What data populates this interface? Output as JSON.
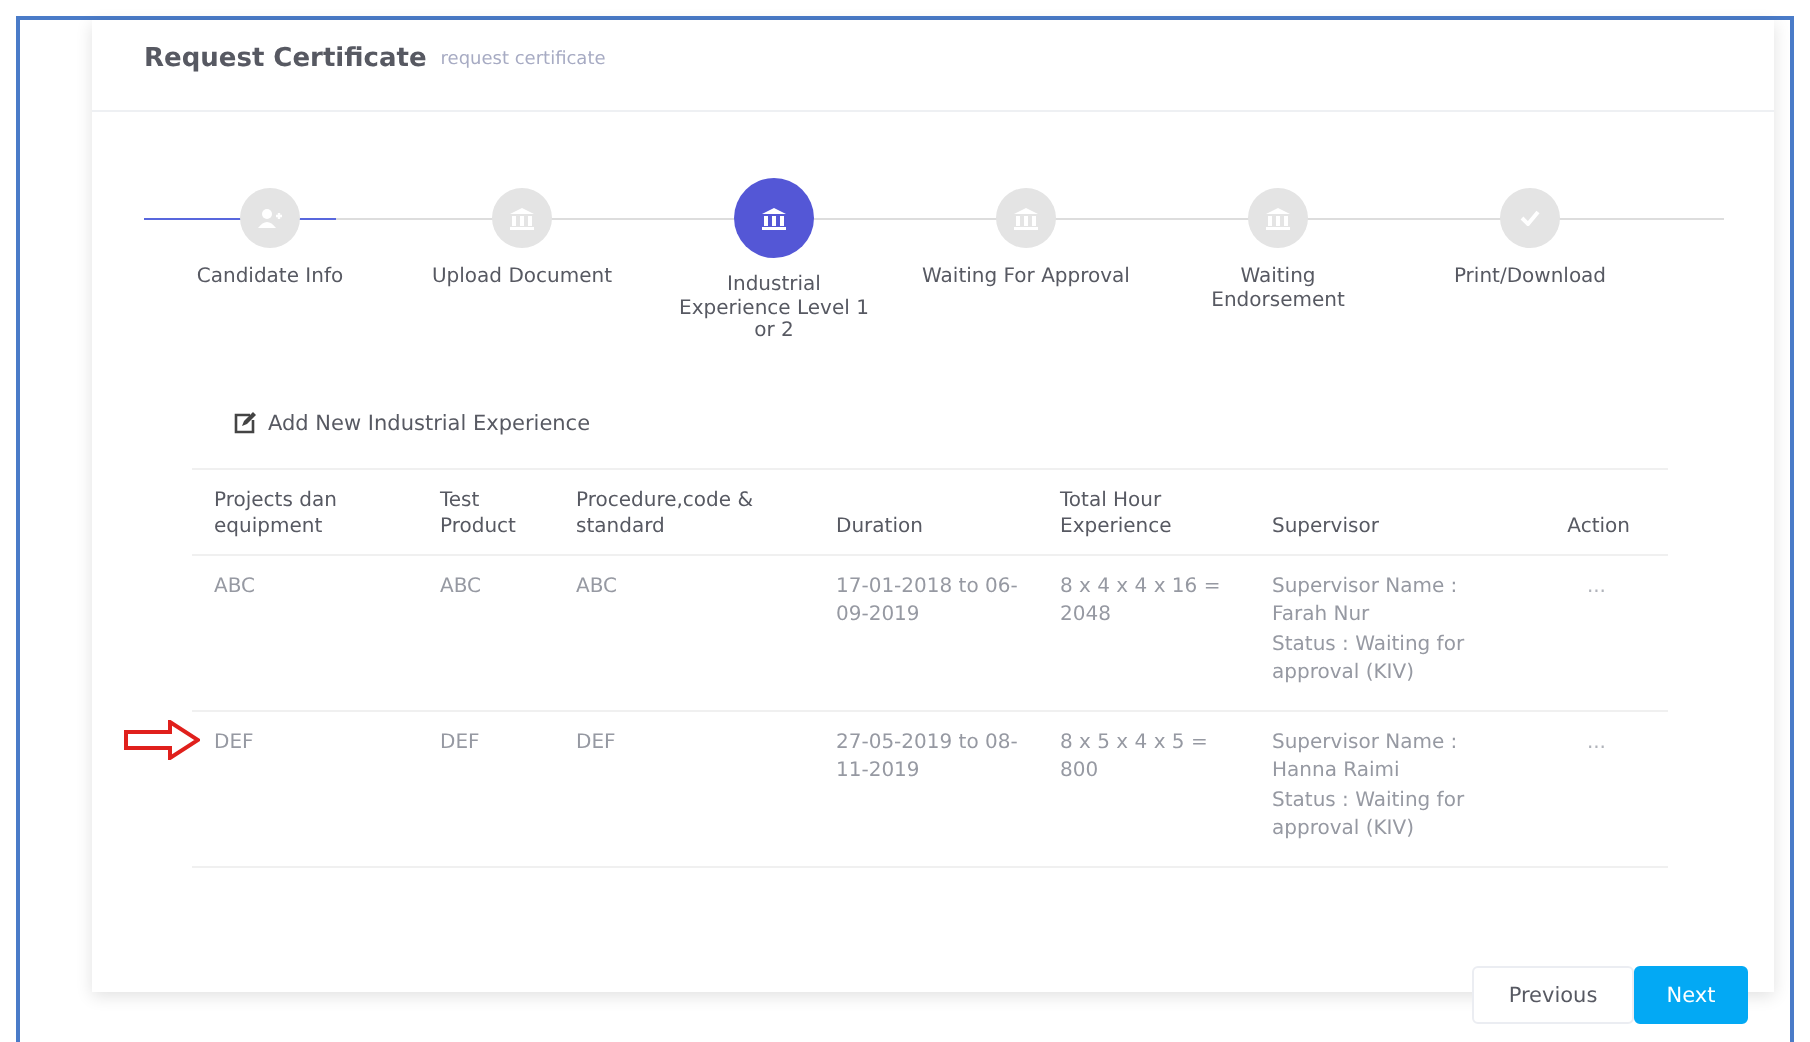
{
  "header": {
    "title": "Request Certificate",
    "subtitle": "request certificate"
  },
  "steps": [
    {
      "label": "Candidate Info",
      "selected": false,
      "line_highlighted": true
    },
    {
      "label": "Upload Document",
      "selected": false,
      "line_highlighted": false
    },
    {
      "label": "Industrial Experience Level 1 or 2",
      "selected": true,
      "line_highlighted": false
    },
    {
      "label": "Waiting For Approval",
      "selected": false,
      "line_highlighted": false
    },
    {
      "label": "Waiting Endorsement",
      "selected": false,
      "line_highlighted": false
    },
    {
      "label": "Print/Download",
      "selected": false,
      "line_highlighted": false
    }
  ],
  "add_link": "Add New Industrial Experience",
  "table": {
    "columns": [
      "Projects dan equipment",
      "Test Product",
      "Procedure,code & standard",
      "Duration",
      "Total Hour Experience",
      "Supervisor",
      "Action"
    ],
    "rows": [
      {
        "cells": [
          "ABC",
          "ABC",
          "ABC",
          "17-01-2018 to 06-09-2019",
          "8 x 4 x 4 x 16 = 2048",
          "Supervisor Name : Farah Nur\nStatus : Waiting for approval (KIV)",
          "..."
        ],
        "pointed": false
      },
      {
        "cells": [
          "DEF",
          "DEF",
          "DEF",
          "27-05-2019 to 08-11-2019",
          "8 x 5 x 4 x 5 = 800",
          "Supervisor Name : Hanna Raimi\nStatus : Waiting for approval (KIV)",
          "..."
        ],
        "pointed": true
      }
    ]
  },
  "buttons": {
    "previous": "Previous",
    "next": "Next"
  }
}
